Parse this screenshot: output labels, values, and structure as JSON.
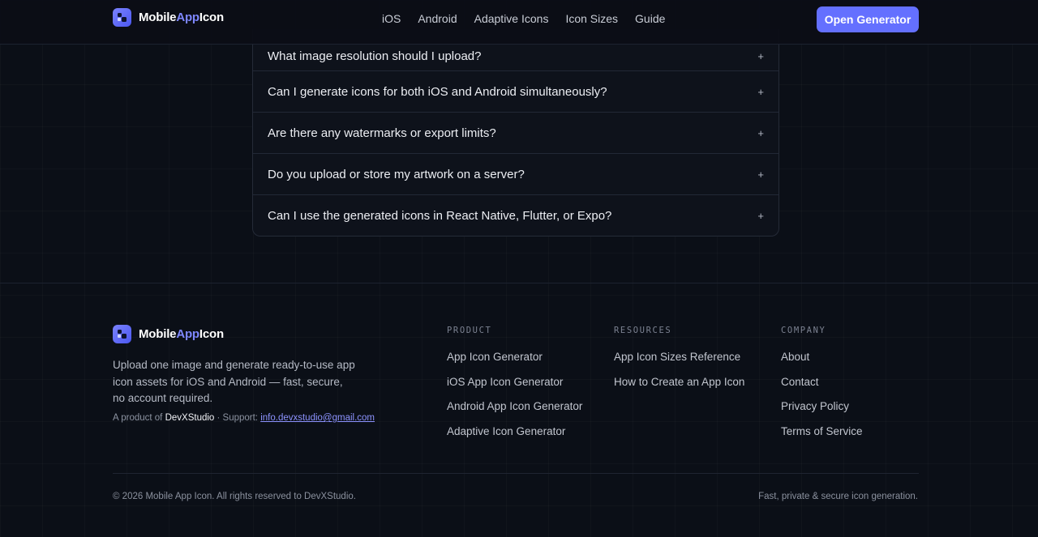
{
  "brand": {
    "name_part1": "Mobile",
    "name_part2": "App",
    "name_part3": "Icon",
    "accent_color": "#6470ff"
  },
  "nav": {
    "items": [
      "iOS",
      "Android",
      "Adaptive Icons",
      "Icon Sizes",
      "Guide"
    ],
    "cta_label": "Open Generator"
  },
  "faq": {
    "items": [
      {
        "question": "What image resolution should I upload?",
        "toggle": "+"
      },
      {
        "question": "Can I generate icons for both iOS and Android simultaneously?",
        "toggle": "+"
      },
      {
        "question": "Are there any watermarks or export limits?",
        "toggle": "+"
      },
      {
        "question": "Do you upload or store my artwork on a server?",
        "toggle": "+"
      },
      {
        "question": "Can I use the generated icons in React Native, Flutter, or Expo?",
        "toggle": "+"
      }
    ]
  },
  "footer": {
    "description": "Upload one image and generate ready-to-use app icon assets for iOS and Android — fast, secure, no account required.",
    "credit_prefix": "A product of ",
    "credit_brand": "DevXStudio",
    "credit_support": " · Support: ",
    "credit_email": "info.devxstudio@gmail.com",
    "columns": [
      {
        "title": "PRODUCT",
        "links": [
          "App Icon Generator",
          "iOS App Icon Generator",
          "Android App Icon Generator",
          "Adaptive Icon Generator"
        ]
      },
      {
        "title": "RESOURCES",
        "links": [
          "App Icon Sizes Reference",
          "How to Create an App Icon"
        ]
      },
      {
        "title": "COMPANY",
        "links": [
          "About",
          "Contact",
          "Privacy Policy",
          "Terms of Service"
        ]
      }
    ],
    "copyright": "© 2026 Mobile App Icon. All rights reserved to DevXStudio.",
    "tagline": "Fast, private & secure icon generation."
  }
}
